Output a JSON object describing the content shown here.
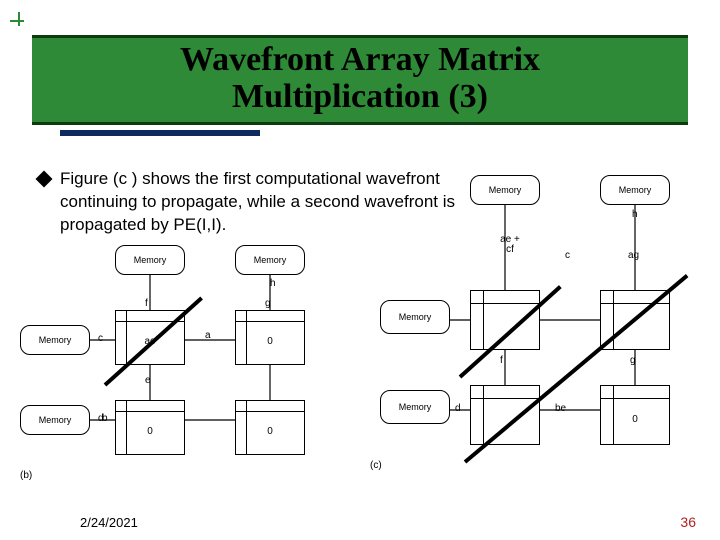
{
  "title_line1": "Wavefront Array Matrix",
  "title_line2": "Multiplication (3)",
  "bullet_text": "Figure (c ) shows the first computational wavefront continuing to propagate, while a second wavefront is propagated by PE(I,I).",
  "memory_label": "Memory",
  "fig_b": {
    "caption": "(b)",
    "top_mem_out": {
      "left": "h",
      "right": ""
    },
    "left_mem_out": {
      "top": "c",
      "bottom": "d"
    },
    "rows_inbetween": {
      "r1c1_right": "a",
      "r1_top_left": "f",
      "r1_top_right": "g",
      "r2_left": "b",
      "r1c1_bottom": "e"
    },
    "pe_values": {
      "r1c1": "ae",
      "r1c2": "0",
      "r2c1": "0",
      "r2c2": "0"
    }
  },
  "fig_c": {
    "caption": "(c)",
    "top_mem_out": {
      "left": "",
      "right": "h"
    },
    "cols_inbetween": {
      "c1_top": "ae + cf",
      "c2_top": "c",
      "c3_top": "ag"
    },
    "rows_inbetween": {
      "r2_left": "d",
      "r2c1_right": "be",
      "r1c2_left": "f",
      "r1c2_right": "g"
    },
    "pe_values": {
      "r1c1": "",
      "r1c2": "",
      "r2c1": "",
      "r2c2": "0"
    }
  },
  "footer": {
    "date": "2/24/2021",
    "page": "36"
  }
}
